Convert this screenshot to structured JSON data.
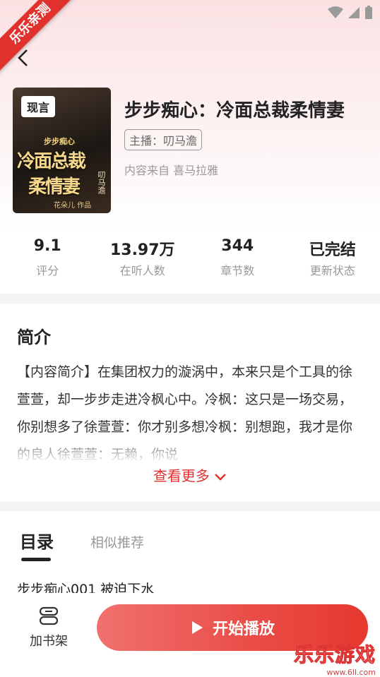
{
  "ribbon": {
    "text": "乐乐亲测"
  },
  "book": {
    "cover_tag": "现言",
    "cover_subtitle": "步步痴心",
    "cover_title_line1": "冷面总裁",
    "cover_title_line2": "柔情妻",
    "cover_side_text": "叨马澹",
    "cover_author": "花朵儿 作品",
    "title": "步步痴心：冷面总裁柔情妻",
    "anchor": "主播：叨马澹",
    "source": "内容来自 喜马拉雅"
  },
  "stats": [
    {
      "value": "9.1",
      "label": "评分"
    },
    {
      "value": "13.97万",
      "label": "在听人数"
    },
    {
      "value": "344",
      "label": "章节数"
    },
    {
      "value": "已完结",
      "label": "更新状态"
    }
  ],
  "intro": {
    "heading": "简介",
    "text": "【内容简介】在集团权力的漩涡中，本来只是个工具的徐萱萱，却一步步走进冷枫心中。冷枫：这只是一场交易，你别想多了徐萱萱：你才别多想冷枫：别想跑，我才是你的良人徐萱萱：无赖，你说",
    "more": "查看更多"
  },
  "tabs": {
    "active": "目录",
    "other": "相似推荐"
  },
  "chapter_first": "步步痴心001 被迫下水",
  "bottom": {
    "shelf_label": "加书架",
    "play_label": "开始播放"
  },
  "watermark": {
    "title": "乐乐游戏",
    "url": "www.6ll.com"
  },
  "colors": {
    "accent": "#e0312d",
    "play_start": "#f0716e",
    "play_end": "#e6392f"
  }
}
